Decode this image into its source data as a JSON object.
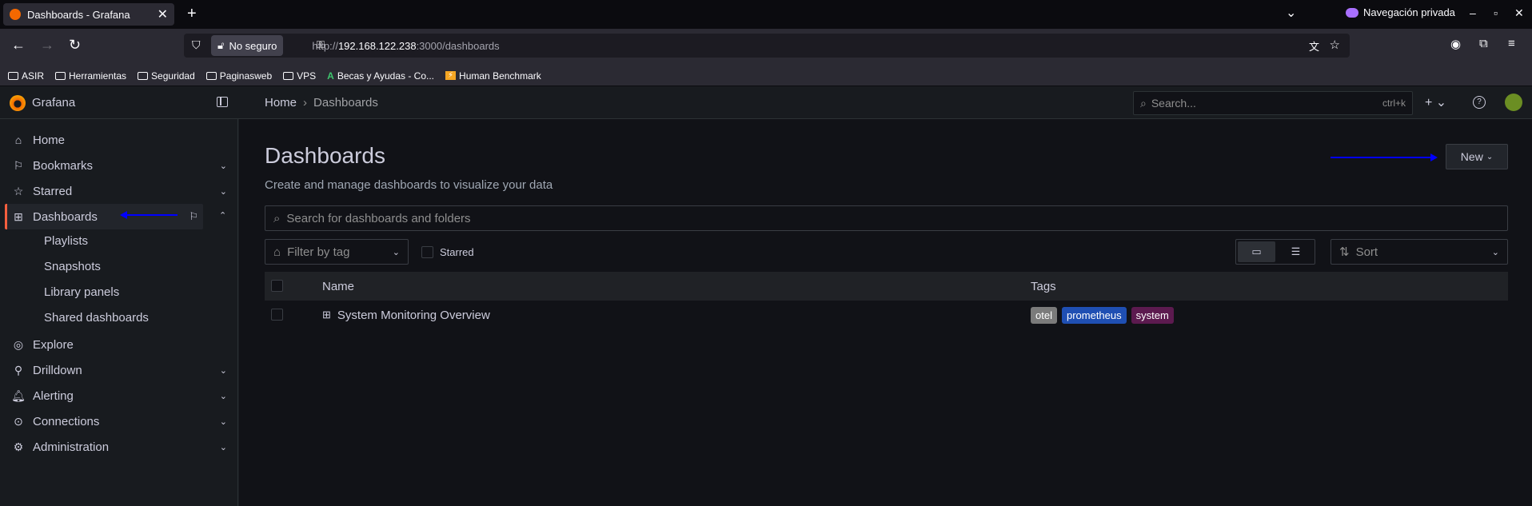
{
  "browser": {
    "tab_title": "Dashboards - Grafana",
    "private_label": "Navegación privada",
    "security_label": "No seguro",
    "url_prefix": "http://",
    "url_host": "192.168.122.238",
    "url_rest": ":3000/dashboards",
    "bookmarks": [
      "ASIR",
      "Herramientas",
      "Seguridad",
      "Paginasweb",
      "VPS",
      "Becas y Ayudas - Co...",
      "Human Benchmark"
    ]
  },
  "grafana": {
    "brand": "Grafana",
    "breadcrumb": {
      "home": "Home",
      "current": "Dashboards"
    },
    "search_placeholder": "Search...",
    "search_shortcut": "ctrl+k",
    "nav": {
      "home": "Home",
      "bookmarks": "Bookmarks",
      "starred": "Starred",
      "dashboards": "Dashboards",
      "playlists": "Playlists",
      "snapshots": "Snapshots",
      "library_panels": "Library panels",
      "shared_dashboards": "Shared dashboards",
      "explore": "Explore",
      "drilldown": "Drilldown",
      "alerting": "Alerting",
      "connections": "Connections",
      "administration": "Administration"
    },
    "page": {
      "title": "Dashboards",
      "subtitle": "Create and manage dashboards to visualize your data",
      "new_button": "New",
      "search_placeholder": "Search for dashboards and folders",
      "filter_by_tag": "Filter by tag",
      "starred_label": "Starred",
      "sort_label": "Sort",
      "columns": {
        "name": "Name",
        "tags": "Tags"
      },
      "rows": [
        {
          "name": "System Monitoring Overview",
          "tags": [
            {
              "label": "otel",
              "color": "#7b7b7b"
            },
            {
              "label": "prometheus",
              "color": "#1f4fb3"
            },
            {
              "label": "system",
              "color": "#5c1a4f"
            }
          ]
        }
      ]
    }
  }
}
